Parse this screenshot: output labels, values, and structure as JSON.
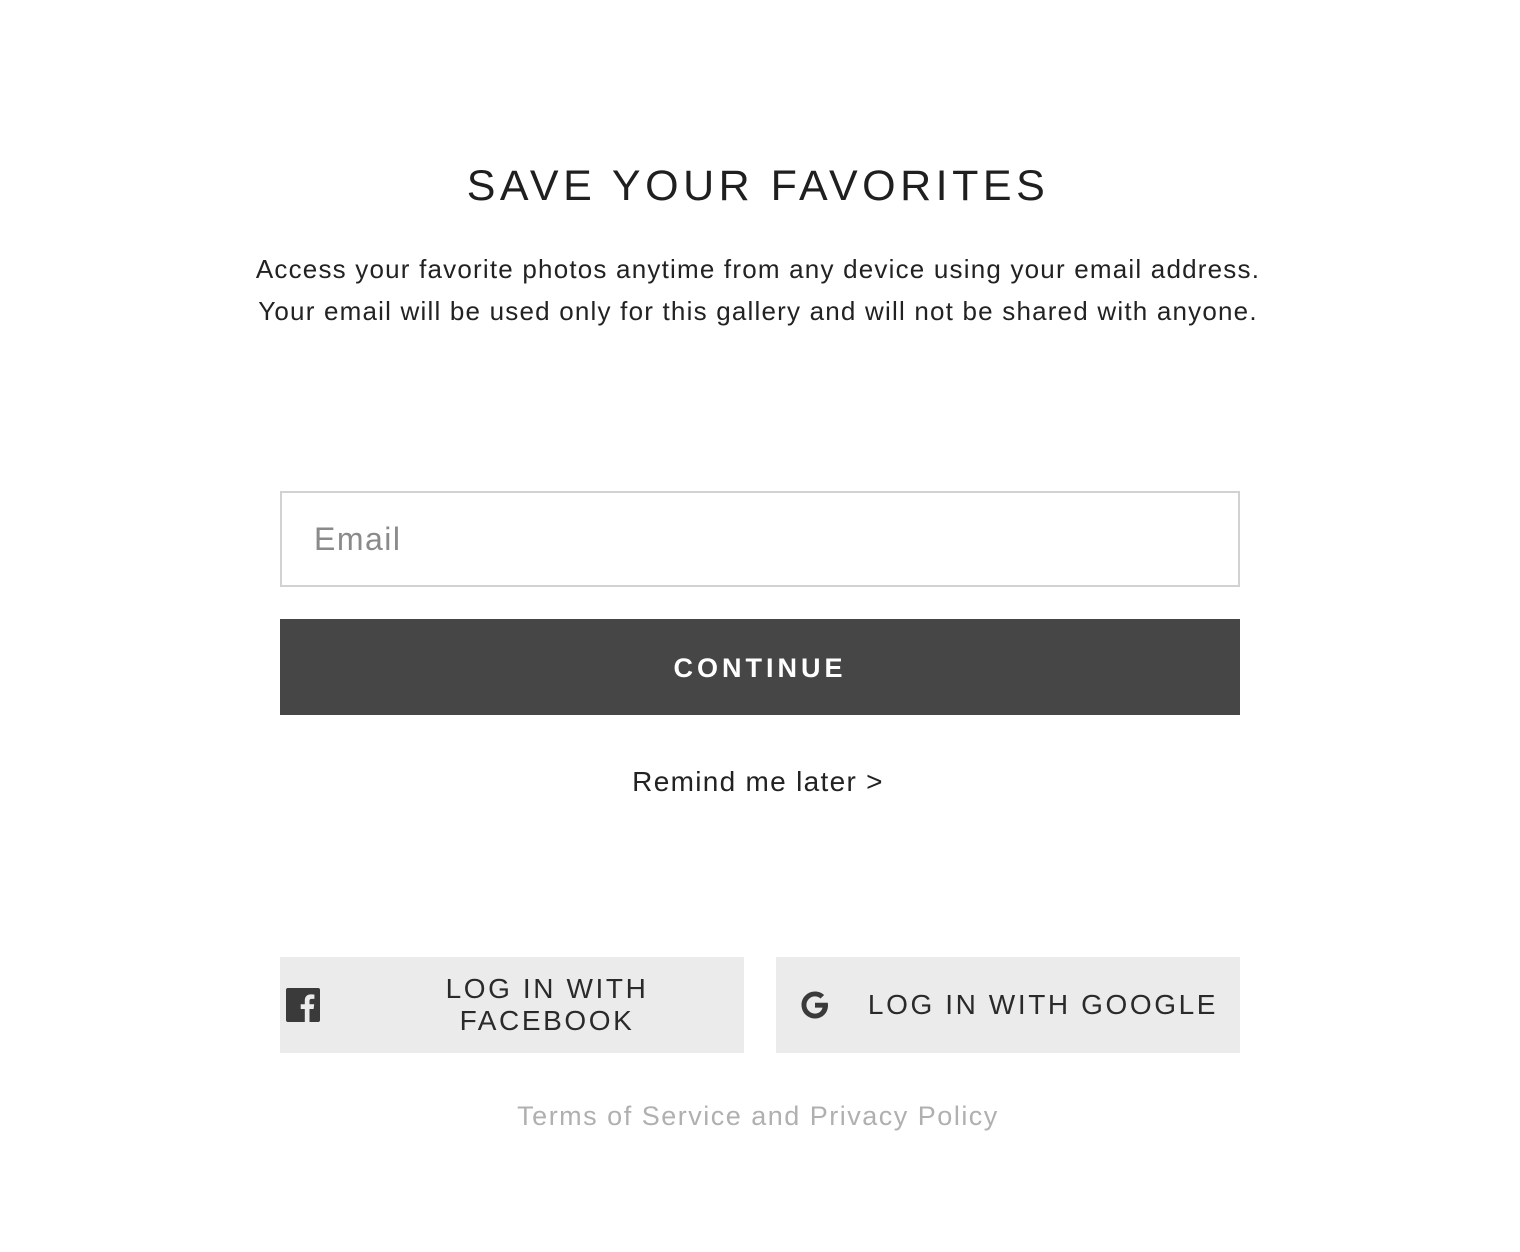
{
  "header": {
    "title": "SAVE YOUR FAVORITES",
    "description_line1": "Access your favorite photos anytime from any device using your email address.",
    "description_line2": "Your email will be used only for this gallery and will not be shared with anyone."
  },
  "form": {
    "email_placeholder": "Email",
    "email_value": "",
    "continue_label": "CONTINUE",
    "remind_label": "Remind me later >"
  },
  "social": {
    "facebook_label": "LOG IN WITH FACEBOOK",
    "facebook_icon": "facebook-icon",
    "google_label": "LOG IN WITH GOOGLE",
    "google_icon": "google-icon"
  },
  "footer": {
    "terms_label": "Terms of Service and Privacy Policy"
  },
  "colors": {
    "primary_button": "#464646",
    "social_button_bg": "#ebebeb",
    "input_border": "#d2d2d2",
    "muted_text": "#b0b0b0"
  }
}
